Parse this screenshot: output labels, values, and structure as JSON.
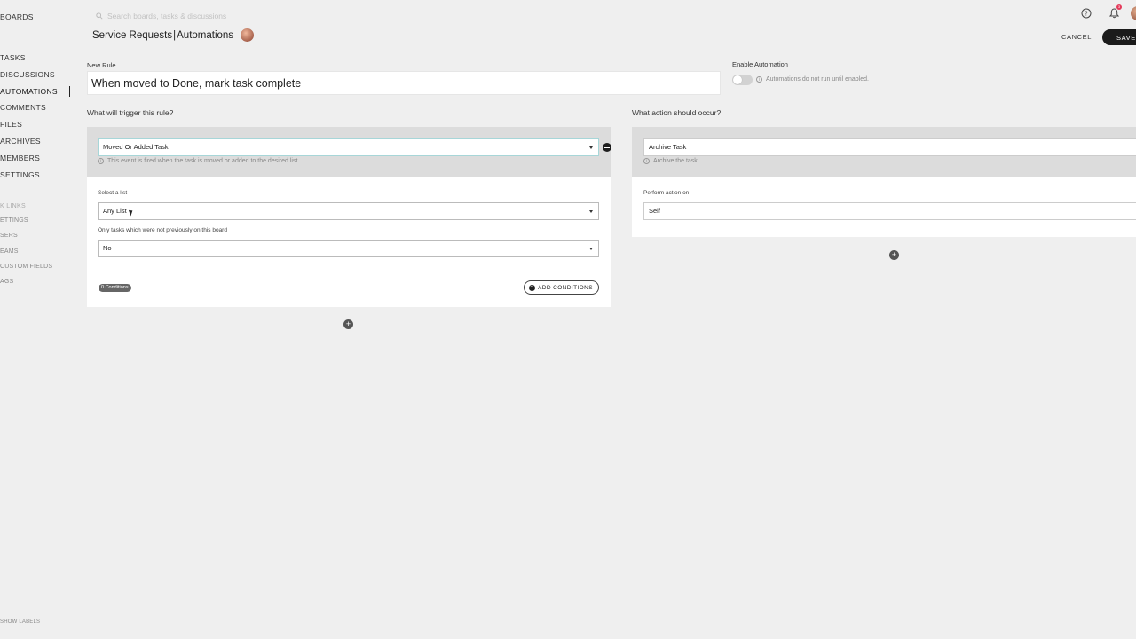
{
  "sidebar": {
    "boards_label": "BOARDS",
    "nav": [
      "TASKS",
      "DISCUSSIONS",
      "AUTOMATIONS",
      "COMMENTS",
      "FILES",
      "ARCHIVES",
      "MEMBERS",
      "SETTINGS"
    ],
    "active": "AUTOMATIONS",
    "quick_links_title": "K LINKS",
    "quick_links": [
      "ETTINGS",
      "SERS",
      "EAMS",
      "CUSTOM FIELDS",
      "AGS"
    ],
    "show_labels": "SHOW LABELS"
  },
  "header": {
    "search_placeholder": "Search boards, tasks & discussions",
    "board_name": "Service Requests",
    "separator": "|",
    "section": "Automations",
    "notification_count": "3",
    "cancel_label": "CANCEL",
    "save_label": "SAVE"
  },
  "rule": {
    "name_label": "New Rule",
    "name_value": "When moved to Done, mark task complete",
    "enable_label": "Enable Automation",
    "enabled": false,
    "enable_note": "Automations do not run until enabled."
  },
  "trigger": {
    "title": "What will trigger this rule?",
    "event": "Moved Or Added Task",
    "event_hint": "This event is fired when the task is moved or added to the desired list.",
    "list_label": "Select a list",
    "list_value": "Any List",
    "only_new_label": "Only tasks which were not previously on this board",
    "only_new_value": "No",
    "conditions_badge": "0 Conditions",
    "add_conditions_label": "ADD CONDITIONS"
  },
  "action": {
    "title": "What action should occur?",
    "action_value": "Archive Task",
    "action_hint": "Archive the task.",
    "perform_label": "Perform action on",
    "perform_value": "Self"
  },
  "colors": {
    "background": "#efefef",
    "panel_header": "#dcdcdc",
    "save_button": "#1b1b1b",
    "notification_badge": "#e43a5a"
  }
}
